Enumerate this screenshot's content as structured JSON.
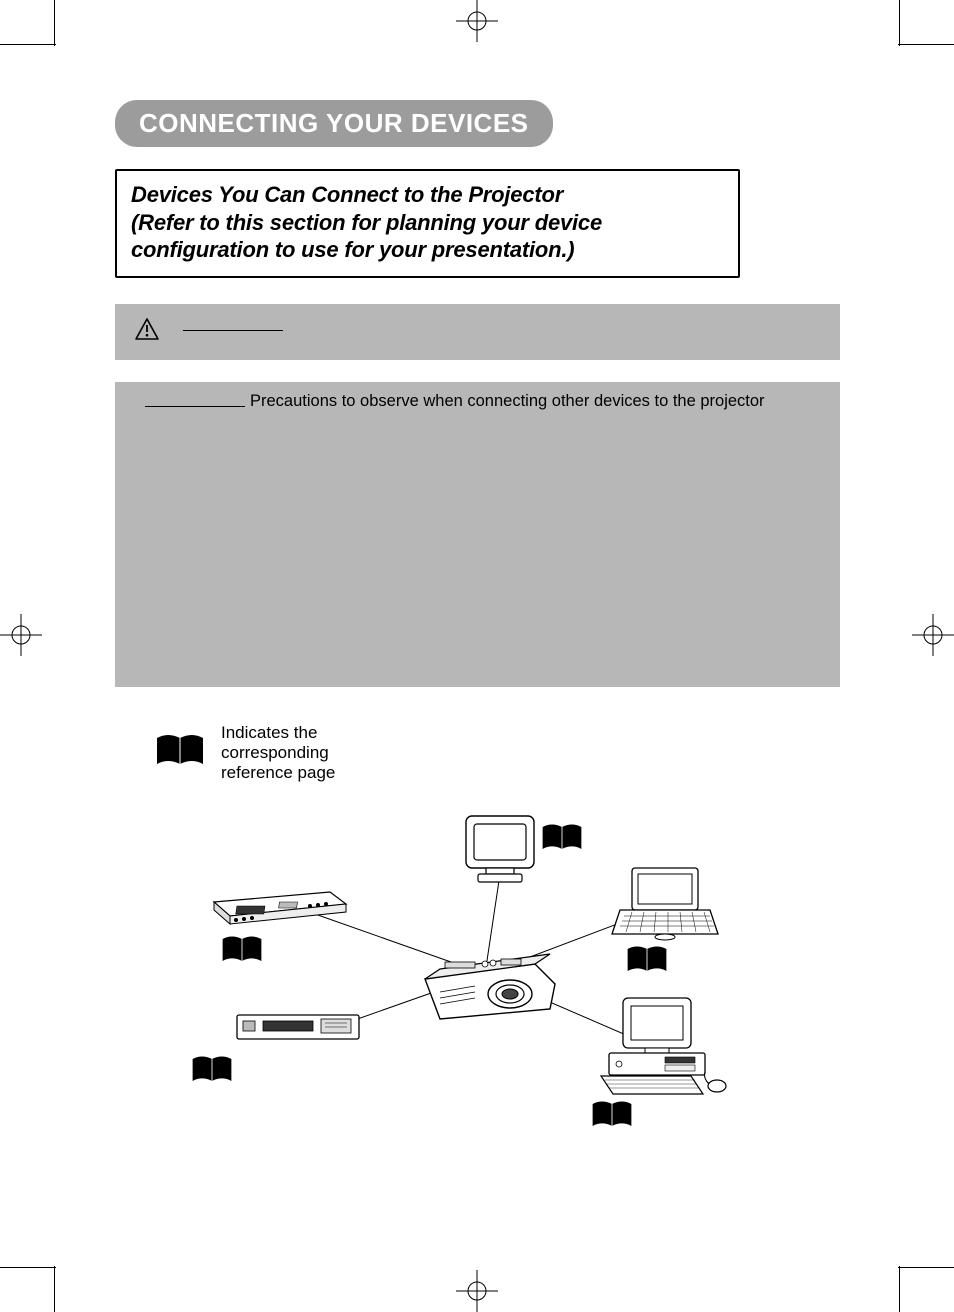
{
  "header": {
    "title": "CONNECTING YOUR DEVICES"
  },
  "subhead": {
    "line1": "Devices You Can Connect to the Projector",
    "line2": "(Refer to this section for planning your device",
    "line3": "configuration to use for your presentation.)"
  },
  "caution": {
    "icon": "warning-triangle-icon"
  },
  "attention": {
    "text": "Precautions to observe when connecting other devices to the projector"
  },
  "legend": {
    "icon": "book-icon",
    "text": "Indicates the corresponding reference page"
  },
  "diagram": {
    "center": "projector",
    "nodes": [
      {
        "id": "vcr",
        "label": "vcr-device"
      },
      {
        "id": "monitor",
        "label": "crt-monitor"
      },
      {
        "id": "laptop",
        "label": "laptop-computer"
      },
      {
        "id": "dvd",
        "label": "dvd-player"
      },
      {
        "id": "desktop",
        "label": "desktop-computer"
      }
    ]
  }
}
